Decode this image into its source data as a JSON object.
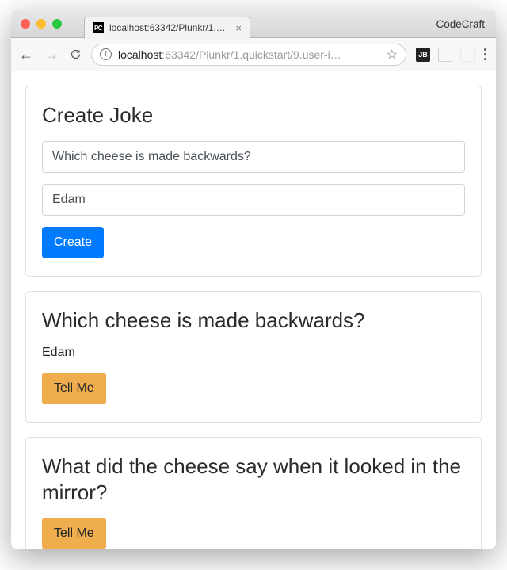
{
  "window": {
    "tab_title": "localhost:63342/Plunkr/1.quic",
    "brand": "CodeCraft"
  },
  "addressbar": {
    "host": "localhost",
    "rest": ":63342/Plunkr/1.quickstart/9.user-i…"
  },
  "ext": {
    "badge": "JB"
  },
  "form": {
    "heading": "Create Joke",
    "setup_value": "Which cheese is made backwards?",
    "punchline_value": "Edam",
    "create_label": "Create"
  },
  "jokes": [
    {
      "setup": "Which cheese is made backwards?",
      "punchline": "Edam",
      "show_punchline": true,
      "button_label": "Tell Me"
    },
    {
      "setup": "What did the cheese say when it looked in the mirror?",
      "punchline": "",
      "show_punchline": false,
      "button_label": "Tell Me"
    }
  ]
}
